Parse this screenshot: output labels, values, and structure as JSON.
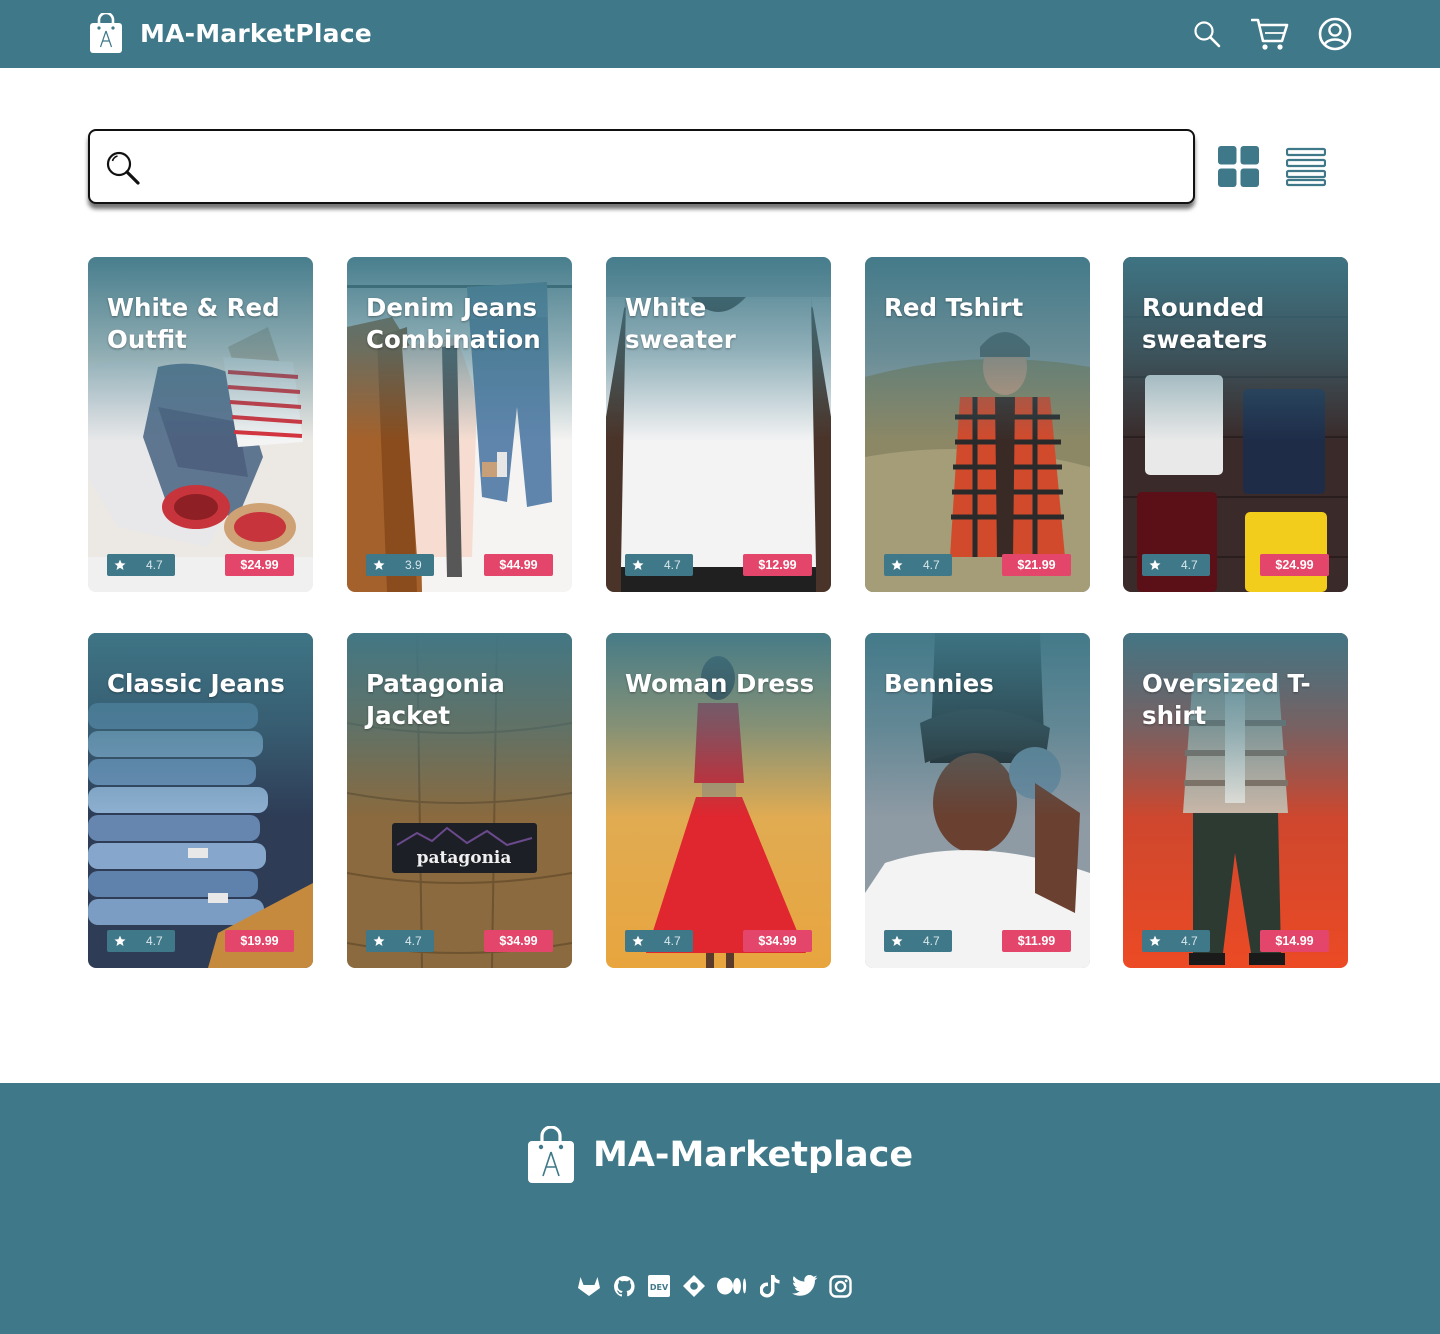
{
  "header": {
    "brand_name": "MA-MarketPlace",
    "icons": [
      "search-icon",
      "cart-icon",
      "user-icon"
    ]
  },
  "search": {
    "value": "",
    "placeholder": ""
  },
  "view_toggle": {
    "options": [
      "grid-view-icon",
      "list-view-icon"
    ],
    "selected": "grid-view-icon"
  },
  "products": [
    {
      "title": "White & Red Outfit",
      "rating": "4.7",
      "price": "$24.99"
    },
    {
      "title": "Denim Jeans Combination",
      "rating": "3.9",
      "price": "$44.99"
    },
    {
      "title": "White sweater",
      "rating": "4.7",
      "price": "$12.99"
    },
    {
      "title": "Red Tshirt",
      "rating": "4.7",
      "price": "$21.99"
    },
    {
      "title": "Rounded sweaters",
      "rating": "4.7",
      "price": "$24.99"
    },
    {
      "title": "Classic Jeans",
      "rating": "4.7",
      "price": "$19.99"
    },
    {
      "title": "Patagonia Jacket",
      "rating": "4.7",
      "price": "$34.99"
    },
    {
      "title": "Woman Dress",
      "rating": "4.7",
      "price": "$34.99"
    },
    {
      "title": "Bennies",
      "rating": "4.7",
      "price": "$11.99"
    },
    {
      "title": "Oversized T-shirt",
      "rating": "4.7",
      "price": "$14.99"
    }
  ],
  "footer": {
    "brand_name": "MA-Marketplace",
    "socials": [
      "gitlab-icon",
      "github-icon",
      "dev-icon",
      "hashnode-icon",
      "medium-icon",
      "tiktok-icon",
      "twitter-icon",
      "instagram-icon"
    ],
    "dev_label": "DEV"
  },
  "colors": {
    "primary": "#3f7888",
    "price_badge": "#e3466a",
    "white": "#ffffff"
  }
}
